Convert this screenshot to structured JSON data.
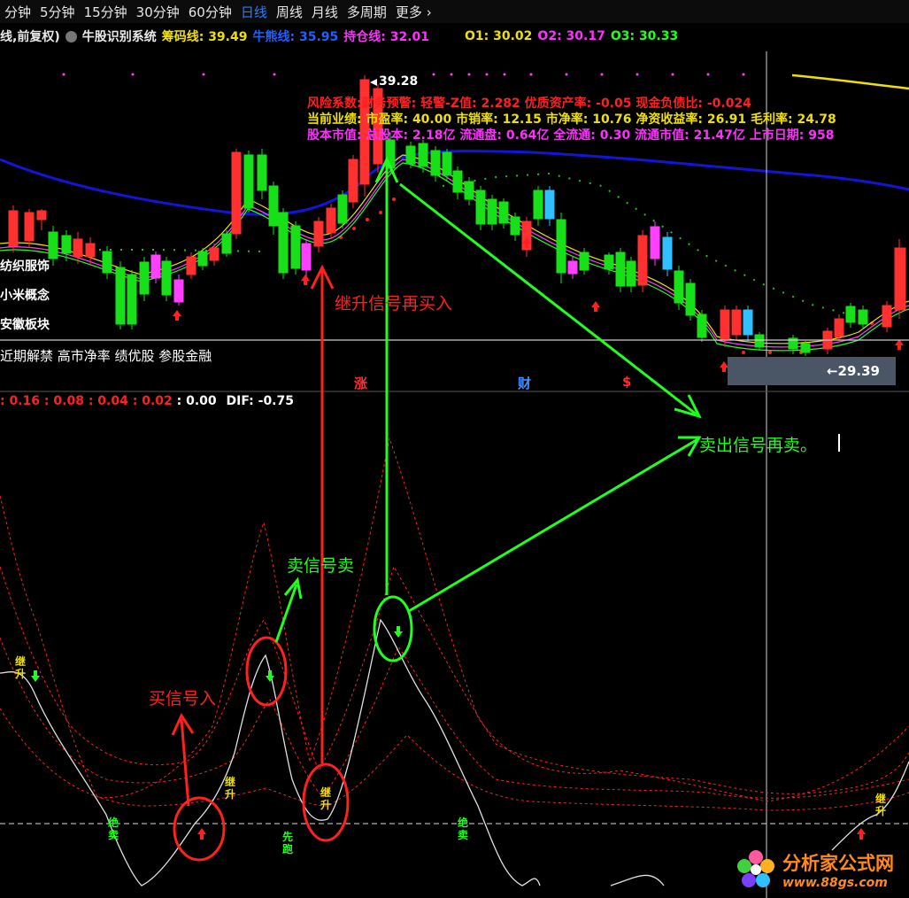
{
  "tabs": [
    "分钟",
    "5分钟",
    "15分钟",
    "30分钟",
    "60分钟",
    "日线",
    "周线",
    "月线",
    "多周期",
    "更多"
  ],
  "active_tab": "日线",
  "info": {
    "mode": "线,前复权)",
    "system": "牛股识别系统",
    "chouma": "筹码线: 39.49",
    "niuxiong": "牛熊线: 35.95",
    "chicang": "持仓线: 32.01",
    "o1": "O1: 30.02",
    "o2": "O2: 30.17",
    "o3": "O3: 30.33"
  },
  "fundamentals": {
    "line1": "风险系数:财务预警: 轻警-Z值: 2.282 优质资产率: -0.05 现金负债比: -0.024",
    "line2": "当前业绩: 市盈率: 40.00 市销率: 12.15 市净率: 10.76 净资收益率: 26.91 毛利率: 24.78",
    "line3": "股本市值: 总股本: 2.18亿 流通盘: 0.64亿 全流通: 0.30 流通市值: 21.47亿 上市日期: 958"
  },
  "price_labels": {
    "high": "39.28",
    "low": "29.39"
  },
  "blocks": [
    "纺织服饰",
    "小米概念",
    "安徽板块"
  ],
  "tags_line": "近期解禁 高市净率 绩优股 参股金融",
  "event_markers": [
    "涨",
    "财",
    "$"
  ],
  "macd": {
    "a": "0.16",
    "b": "0.08",
    "c": "0.04",
    "d": "0.02",
    "e": "0.00",
    "dif": "DIF: -0.75"
  },
  "annotations": {
    "buy": "买信号入",
    "sell": "卖信号卖",
    "rebuy": "继升信号再买入",
    "resell": "卖出信号再卖。"
  },
  "signal_labels": {
    "jisheng": "继升",
    "xianpao": "先跑",
    "jueyi": "绝卖"
  },
  "watermark": {
    "title": "分析家公式网",
    "url": "www.88gs.com"
  },
  "colors": {
    "up": "#ff3030",
    "down": "#18e018",
    "ma_blue": "#1414d8",
    "ma_yellow": "#f0e000",
    "annotation_red": "#ff2020",
    "annotation_green": "#20ff20"
  }
}
